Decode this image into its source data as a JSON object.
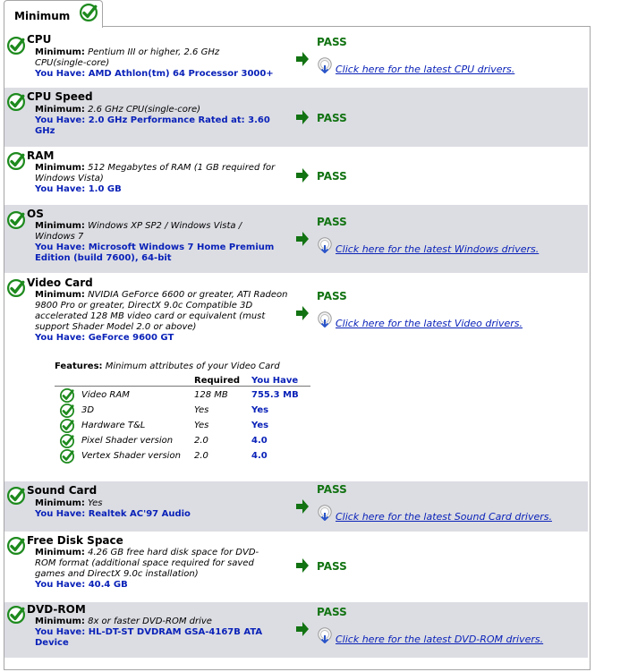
{
  "tab": {
    "label": "Minimum"
  },
  "pass_label": "PASS",
  "colors": {
    "pass": "#127312",
    "have": "#0a22b8",
    "shade": "#dcdde3",
    "check": "#1d8a1d"
  },
  "components": [
    {
      "title": "CPU",
      "min_label": "Minimum:",
      "min_text": "Pentium III or higher, 2.6 GHz CPU(single-core)",
      "have_label": "You Have:",
      "have_text": "AMD Athlon(tm) 64 Processor 3000+",
      "link": "Click here for the latest CPU drivers."
    },
    {
      "title": "CPU Speed",
      "min_label": "Minimum:",
      "min_text": "2.6 GHz CPU(single-core)",
      "have_label": "You Have:",
      "have_text": "2.0 GHz Performance Rated at: 3.60 GHz"
    },
    {
      "title": "RAM",
      "min_label": "Minimum:",
      "min_text": "512 Megabytes of RAM (1 GB required for Windows Vista)",
      "have_label": "You Have:",
      "have_text": "1.0 GB"
    },
    {
      "title": "OS",
      "min_label": "Minimum:",
      "min_text": "Windows XP SP2 / Windows Vista / Windows 7",
      "have_label": "You Have:",
      "have_text": "Microsoft Windows 7 Home Premium Edition (build 7600), 64-bit",
      "link": "Click here for the latest Windows drivers."
    },
    {
      "title": "Video Card",
      "min_label": "Minimum:",
      "min_text": "NVIDIA GeForce 6600 or greater, ATI Radeon 9800 Pro or greater, DirectX 9.0c Compatible 3D accelerated 128 MB video card or equivalent (must support Shader Model 2.0 or above)",
      "have_label": "You Have:",
      "have_text": "GeForce 9600 GT",
      "link": "Click here for the latest Video drivers."
    },
    {
      "title": "Sound Card",
      "min_label": "Minimum:",
      "min_text": "Yes",
      "have_label": "You Have:",
      "have_text": "Realtek AC'97 Audio",
      "link": "Click here for the latest Sound Card drivers."
    },
    {
      "title": "Free Disk Space",
      "min_label": "Minimum:",
      "min_text": "4.26 GB free hard disk space for DVD-ROM format (additional space required for saved games and DirectX 9.0c installation)",
      "have_label": "You Have:",
      "have_text": "40.4 GB"
    },
    {
      "title": "DVD-ROM",
      "min_label": "Minimum:",
      "min_text": "8x or faster DVD-ROM drive",
      "have_label": "You Have:",
      "have_text": "HL-DT-ST DVDRAM GSA-4167B ATA Device",
      "link": "Click here for the latest DVD-ROM drivers."
    }
  ],
  "features": {
    "label": "Features:",
    "text": "Minimum attributes of your Video Card",
    "col_required": "Required",
    "col_have": "You Have",
    "rows": [
      {
        "name": "Video RAM",
        "required": "128 MB",
        "have": "755.3 MB"
      },
      {
        "name": "3D",
        "required": "Yes",
        "have": "Yes"
      },
      {
        "name": "Hardware T&L",
        "required": "Yes",
        "have": "Yes"
      },
      {
        "name": "Pixel Shader version",
        "required": "2.0",
        "have": "4.0"
      },
      {
        "name": "Vertex Shader version",
        "required": "2.0",
        "have": "4.0"
      }
    ]
  }
}
